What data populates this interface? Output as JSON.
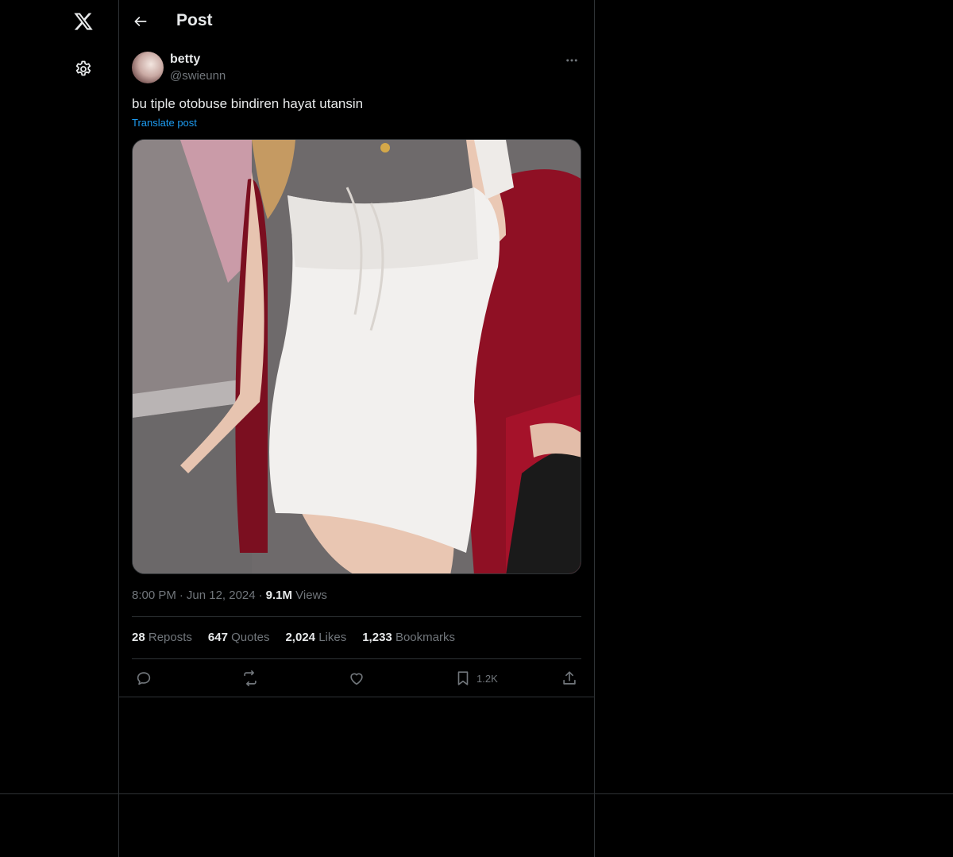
{
  "nav": {
    "logo_icon": "x-logo-icon",
    "settings_icon": "gear-icon"
  },
  "header": {
    "back_icon": "arrow-left-icon",
    "title": "Post"
  },
  "post": {
    "author": {
      "name": "betty",
      "handle": "@swieunn"
    },
    "text": "bu tiple otobuse bindiren hayat utansin",
    "translate_label": "Translate post",
    "time": "8:00 PM",
    "separator": "·",
    "date": "Jun 12, 2024",
    "views_count": "9.1M",
    "views_label": "Views",
    "stats": [
      {
        "count": "28",
        "label": "Reposts"
      },
      {
        "count": "647",
        "label": "Quotes"
      },
      {
        "count": "2,024",
        "label": "Likes"
      },
      {
        "count": "1,233",
        "label": "Bookmarks"
      }
    ],
    "actions": {
      "reply_icon": "reply-icon",
      "repost_icon": "repost-icon",
      "like_icon": "heart-icon",
      "bookmark_icon": "bookmark-icon",
      "bookmark_count": "1.2K",
      "share_icon": "share-icon"
    }
  },
  "colors": {
    "background": "#000000",
    "text_primary": "#e7e9ea",
    "text_secondary": "#71767b",
    "accent": "#1d9bf0",
    "border": "#2f3336"
  }
}
